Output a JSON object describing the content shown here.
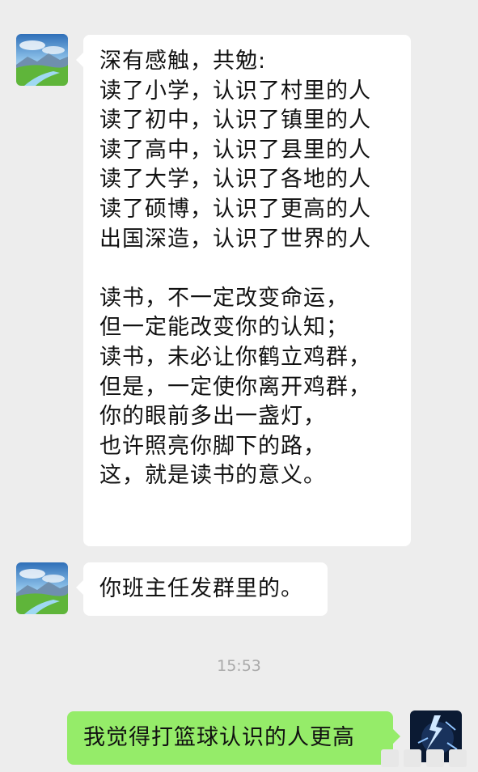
{
  "messages": [
    {
      "side": "left",
      "lines": [
        "深有感触，共勉:",
        "读了小学，认识了村里的人",
        "读了初中，认识了镇里的人",
        "读了高中，认识了县里的人",
        "读了大学，认识了各地的人",
        "读了硕博，认识了更高的人",
        "出国深造，认识了世界的人",
        "",
        "读书，不一定改变命运，",
        "但一定能改变你的认知；",
        "读书，未必让你鹤立鸡群，",
        "但是，一定使你离开鸡群，",
        "你的眼前多出一盏灯，",
        "也许照亮你脚下的路，",
        "这，就是读书的意义。"
      ]
    },
    {
      "side": "left",
      "text": "你班主任发群里的。"
    },
    {
      "side": "right",
      "text": "我觉得打篮球认识的人更高"
    }
  ],
  "timestamp": "15:53",
  "colors": {
    "background": "#ededed",
    "incoming_bubble": "#ffffff",
    "outgoing_bubble": "#95ec69",
    "timestamp": "#a9a9a9"
  },
  "avatars": {
    "left": "landscape-avatar",
    "right": "lightning-avatar"
  }
}
